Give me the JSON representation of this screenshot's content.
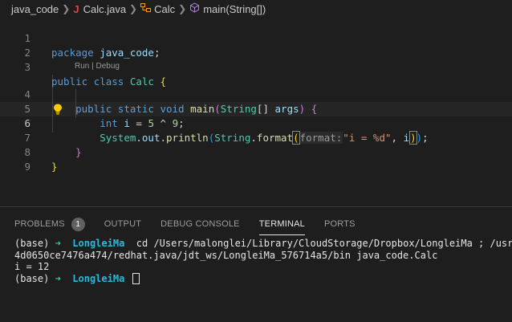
{
  "breadcrumb": {
    "folder": "java_code",
    "file_icon": "J",
    "file": "Calc.java",
    "class_name": "Calc",
    "method": "main(String[])"
  },
  "editor": {
    "codelens": "Run | Debug",
    "line_numbers": [
      "1",
      "2",
      "3",
      "4",
      "5",
      "6",
      "7",
      "8",
      "9"
    ],
    "line1": {
      "kw": "package",
      "name": "java_code",
      "semi": ";"
    },
    "line3": {
      "kw1": "public",
      "kw2": "class",
      "cls": "Calc",
      "brace": "{"
    },
    "line4": {
      "kw1": "public",
      "kw2": "static",
      "kw3": "void",
      "fn": "main",
      "lp": "(",
      "type": "String",
      "arr": "[]",
      "arg": "args",
      "rp": ")",
      "brace": "{"
    },
    "line5": {
      "kw": "int",
      "var": "i",
      "eq": "=",
      "n1": "5",
      "op": "^",
      "n2": "9",
      "semi": ";"
    },
    "line6": {
      "cls": "System",
      "dot1": ".",
      "out": "out",
      "dot2": ".",
      "fn1": "println",
      "lp1": "(",
      "cls2": "String",
      "dot3": ".",
      "fn2": "format",
      "lp2": "(",
      "hint": "format:",
      "str": "\"i = %d\"",
      "comma": ",",
      "arg": "i",
      "rp2": ")",
      "rp1": ")",
      "semi": ";"
    },
    "line7": {
      "brace": "}"
    },
    "line8": {
      "brace": "}"
    }
  },
  "panel": {
    "tabs": [
      "PROBLEMS",
      "OUTPUT",
      "DEBUG CONSOLE",
      "TERMINAL",
      "PORTS"
    ],
    "problems_count": "1",
    "active_tab": "TERMINAL"
  },
  "terminal": {
    "prompt_prefix": "(base)",
    "arrow": "➜",
    "user": "LongleiMa",
    "command_line1": "cd /Users/malonglei/Library/CloudStorage/Dropbox/LongleiMa ; /usr/bi",
    "command_line2": "4d0650ce7476a474/redhat.java/jdt_ws/LongleiMa_576714a5/bin java_code.Calc",
    "output": "i = 12"
  },
  "colors": {
    "editor_bg": "#1e1e1e",
    "keyword": "#569cd6",
    "type": "#4ec9b0",
    "function": "#dcdcaa",
    "variable": "#9cdcfe",
    "number": "#b5cea8",
    "string": "#ce9178",
    "terminal_arrow": "#23d18b",
    "terminal_user": "#29b8db"
  }
}
